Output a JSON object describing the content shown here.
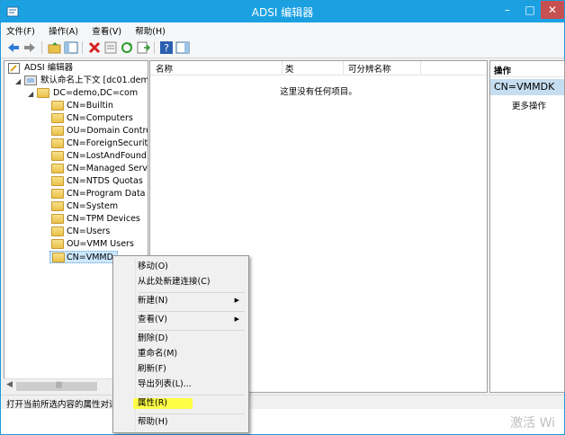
{
  "window": {
    "title": "ADSI 编辑器"
  },
  "menubar": [
    {
      "label": "文件(F)"
    },
    {
      "label": "操作(A)"
    },
    {
      "label": "查看(V)"
    },
    {
      "label": "帮助(H)"
    }
  ],
  "tree": {
    "root": "ADSI 编辑器",
    "context": "默认命名上下文 [dc01.dem",
    "domain": "DC=demo,DC=com",
    "children": [
      "CN=Builtin",
      "CN=Computers",
      "OU=Domain Contro",
      "CN=ForeignSecurit",
      "CN=LostAndFound",
      "CN=Managed Serv",
      "CN=NTDS Quotas",
      "CN=Program Data",
      "CN=System",
      "CN=TPM Devices",
      "CN=Users",
      "OU=VMM Users",
      "CN=VMMD"
    ]
  },
  "list": {
    "columns": [
      "名称",
      "类",
      "可分辨名称"
    ],
    "empty_message": "这里没有任何项目。"
  },
  "actions": {
    "header": "操作",
    "selected": "CN=VMMDK",
    "more": "更多操作"
  },
  "context_menu": {
    "items": [
      {
        "label": "移动(O)"
      },
      {
        "label": "从此处新建连接(C)"
      },
      {
        "label": "新建(N)",
        "submenu": true
      },
      {
        "label": "查看(V)",
        "submenu": true
      },
      {
        "label": "删除(D)"
      },
      {
        "label": "重命名(M)"
      },
      {
        "label": "刷新(F)"
      },
      {
        "label": "导出列表(L)..."
      },
      {
        "label": "属性(R)",
        "highlighted": true
      },
      {
        "label": "帮助(H)"
      }
    ]
  },
  "statusbar": {
    "text": "打开当前所选内容的属性对话"
  },
  "watermark": "激活 Wi"
}
